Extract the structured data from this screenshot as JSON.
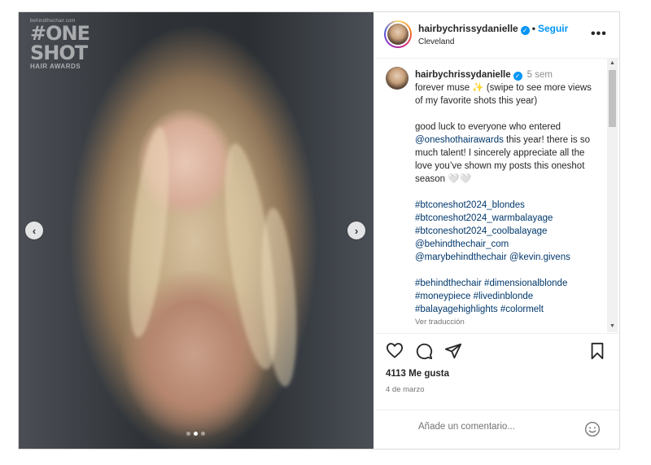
{
  "media": {
    "watermark_url": "behindthechair.com",
    "watermark_title": "#ONE SHOT",
    "watermark_sub": "HAIR AWARDS",
    "nav_prev": "‹",
    "nav_next": "›",
    "slides": 3,
    "active_slide": 2
  },
  "header": {
    "username": "hairbychrissydanielle",
    "verified": true,
    "separator": "•",
    "follow_label": "Seguir",
    "location": "Cleveland",
    "more_label": "•••"
  },
  "caption": {
    "username": "hairbychrissydanielle",
    "time": "5 sem",
    "line1": "forever muse ✨ (swipe to see more views of my favorite shots this year)",
    "line2_pre": "good luck to everyone who entered ",
    "line2_mention": "@oneshothairawards",
    "line2_post": " this year! there is so much talent! I sincerely appreciate all the love you’ve shown my posts this oneshot season 🤍🤍",
    "tags1": [
      "#btconeshot2024_blondes",
      "#btconeshot2024_warmbalayage",
      "#btconeshot2024_coolbalayage",
      "@behindthechair_com"
    ],
    "tags1_last_a": "@marybehindthechair",
    "tags1_last_b": "@kevin.givens",
    "tags2_a": "#behindthechair",
    "tags2_b": "#dimensionalblonde",
    "tags2_c": "#moneypiece",
    "tags2_d": "#livedinblonde",
    "tags2_e": "#balayagehighlights",
    "tags2_f": "#colormelt",
    "translate": "Ver traducción"
  },
  "stats": {
    "likes": "4113 Me gusta",
    "date": "4 de marzo"
  },
  "comment_box": {
    "placeholder": "Añade un comentario..."
  },
  "icons": [
    "heart-icon",
    "comment-icon",
    "share-icon",
    "bookmark-icon",
    "emoji-icon",
    "verified-icon"
  ],
  "colors": {
    "link": "#0095f6",
    "hashtag": "#00376b"
  }
}
